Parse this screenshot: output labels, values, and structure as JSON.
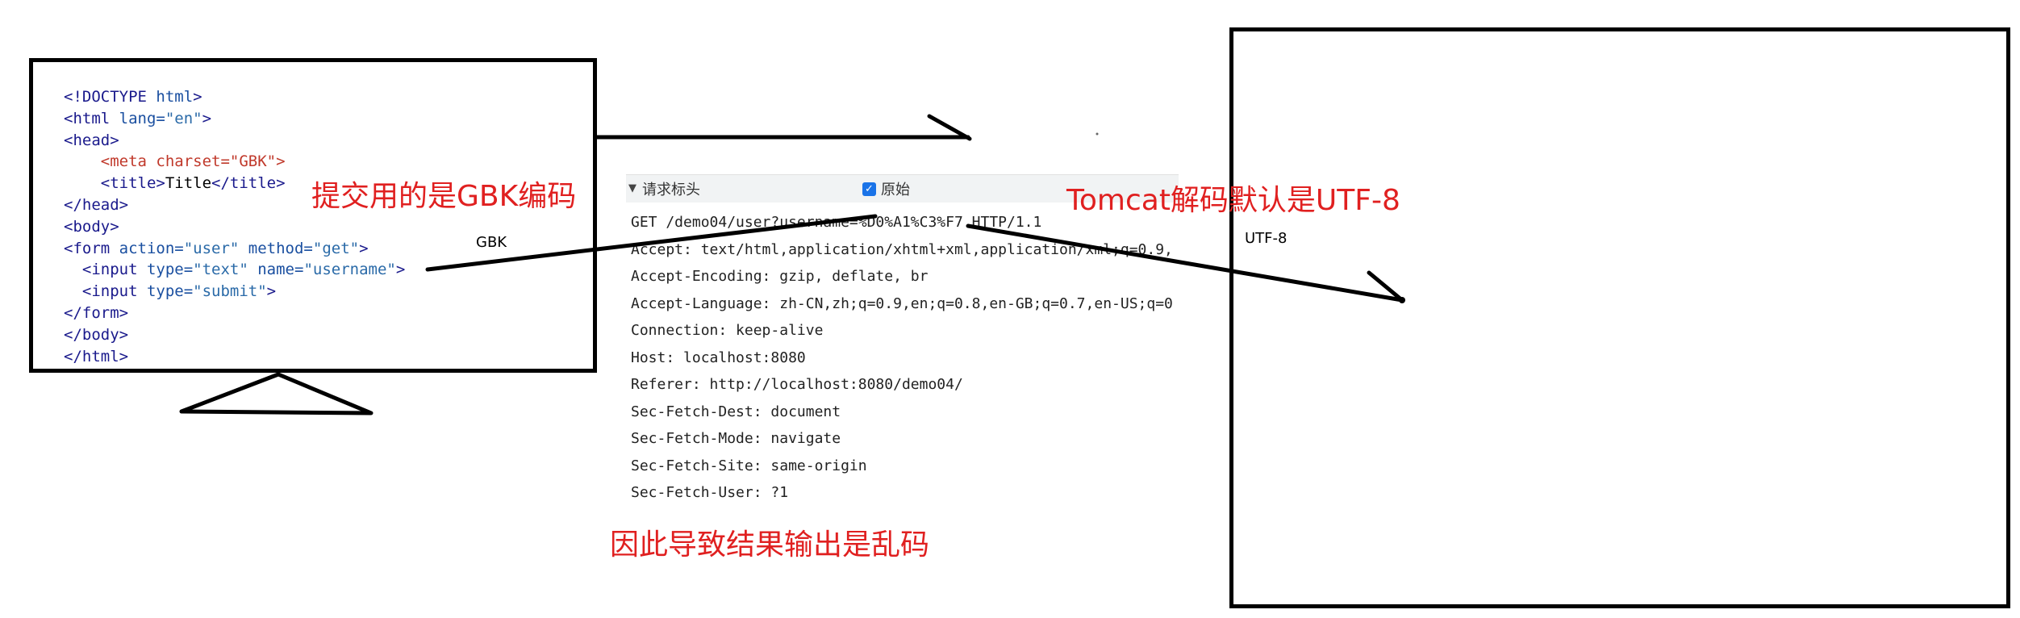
{
  "code_box": {
    "lines": [
      [
        {
          "t": "<!DOCTYPE ",
          "c": "tag"
        },
        {
          "t": "html",
          "c": "attr"
        },
        {
          "t": ">",
          "c": "tag"
        }
      ],
      [
        {
          "t": "<html ",
          "c": "tag"
        },
        {
          "t": "lang=",
          "c": "attr"
        },
        {
          "t": "\"en\"",
          "c": "val"
        },
        {
          "t": ">",
          "c": "tag"
        }
      ],
      [
        {
          "t": "<head>",
          "c": "tag"
        }
      ],
      [
        {
          "t": "    <meta ",
          "c": "meta"
        },
        {
          "t": "charset=",
          "c": "meta"
        },
        {
          "t": "\"GBK\"",
          "c": "meta"
        },
        {
          "t": ">",
          "c": "meta"
        }
      ],
      [
        {
          "t": "    <title>",
          "c": "tag"
        },
        {
          "t": "Title",
          "c": ""
        },
        {
          "t": "</title>",
          "c": "tag"
        }
      ],
      [
        {
          "t": "</head>",
          "c": "tag"
        }
      ],
      [
        {
          "t": "<body>",
          "c": "tag"
        }
      ],
      [
        {
          "t": "<form ",
          "c": "tag"
        },
        {
          "t": "action=",
          "c": "attr"
        },
        {
          "t": "\"user\" ",
          "c": "val"
        },
        {
          "t": "method=",
          "c": "attr"
        },
        {
          "t": "\"get\"",
          "c": "val"
        },
        {
          "t": ">",
          "c": "tag"
        }
      ],
      [
        {
          "t": "  <input ",
          "c": "tag"
        },
        {
          "t": "type=",
          "c": "attr"
        },
        {
          "t": "\"text\" ",
          "c": "val"
        },
        {
          "t": "name=",
          "c": "attr"
        },
        {
          "t": "\"username\"",
          "c": "val"
        },
        {
          "t": ">",
          "c": "tag"
        }
      ],
      [
        {
          "t": "  <input ",
          "c": "tag"
        },
        {
          "t": "type=",
          "c": "attr"
        },
        {
          "t": "\"submit\"",
          "c": "val"
        },
        {
          "t": ">",
          "c": "tag"
        }
      ],
      [
        {
          "t": "</form>",
          "c": "tag"
        }
      ],
      [
        {
          "t": "</body>",
          "c": "tag"
        }
      ],
      [
        {
          "t": "</html>",
          "c": "tag"
        }
      ]
    ]
  },
  "request_panel": {
    "title": "请求标头",
    "raw_checkbox_label": "原始",
    "lines": [
      "GET /demo04/user?username=%D0%A1%C3%F7 HTTP/1.1",
      "Accept: text/html,application/xhtml+xml,application/xml;q=0.9,",
      "Accept-Encoding: gzip, deflate, br",
      "Accept-Language: zh-CN,zh;q=0.9,en;q=0.8,en-GB;q=0.7,en-US;q=0",
      "Connection: keep-alive",
      "Host: localhost:8080",
      "Referer: http://localhost:8080/demo04/",
      "Sec-Fetch-Dest: document",
      "Sec-Fetch-Mode: navigate",
      "Sec-Fetch-Site: same-origin",
      "Sec-Fetch-User: ?1"
    ]
  },
  "annotations": {
    "gbk_submit": "提交用的是GBK编码",
    "gbk_small": "GBK",
    "tomcat_decode": "Tomcat解码默认是UTF-8",
    "result": "因此导致结果输出是乱码",
    "utf8_small": "UTF-8"
  },
  "colors": {
    "annotation": "#e02020",
    "outline": "#000000"
  }
}
